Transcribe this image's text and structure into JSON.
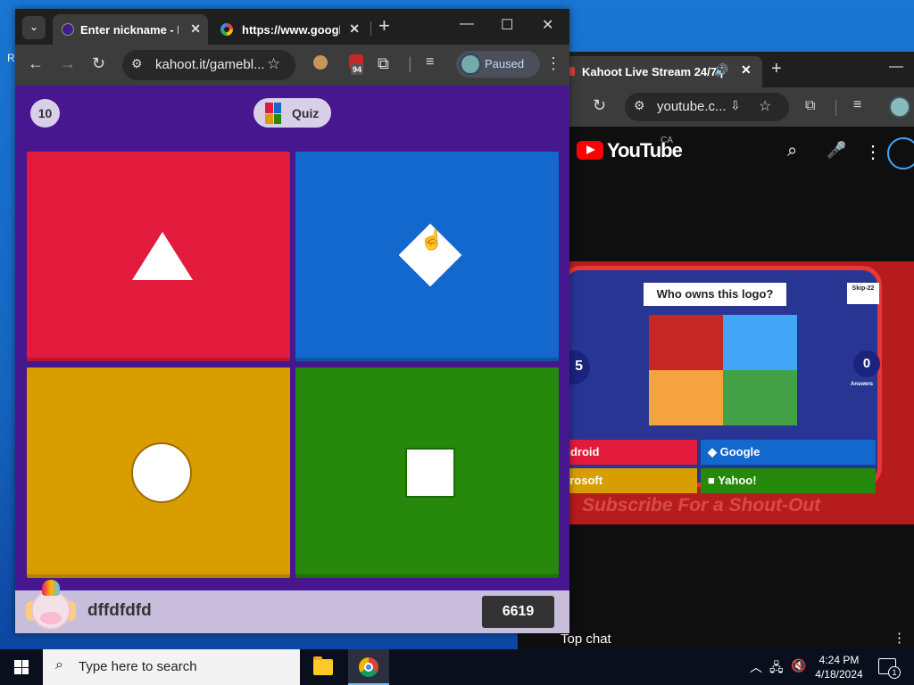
{
  "desktop": {
    "fragment": "R"
  },
  "kahoot_window": {
    "tabs": [
      {
        "title": "Enter nickname - Ka"
      },
      {
        "title": "https://www.google.c"
      }
    ],
    "address": "kahoot.it/gamebl...",
    "extension_badge": "94",
    "profile_status": "Paused"
  },
  "game": {
    "question_number": "10",
    "mode_label": "Quiz",
    "answers": [
      {
        "shape": "triangle-icon",
        "color": "#e21b3c"
      },
      {
        "shape": "diamond-icon",
        "color": "#1368ce"
      },
      {
        "shape": "circle-icon",
        "color": "#d89e00"
      },
      {
        "shape": "square-icon",
        "color": "#26890c"
      }
    ],
    "player": {
      "nickname": "dffdfdfd",
      "score": "6619"
    }
  },
  "youtube_window": {
    "tab_title": "Kahoot Live Stream 24/7 |",
    "address": "youtube.c...",
    "brand": "YouTube",
    "region": "CA",
    "video": {
      "question": "Who owns this logo?",
      "skip": "Skip-22",
      "left_count": "5",
      "answers_count": "0",
      "answers_label": "Answers",
      "options": [
        "ndroid",
        "Google",
        "crosoft",
        "Yahoo!"
      ],
      "overlay_text": "Subscribe For a Shout-Out"
    },
    "chat_label": "Top chat"
  },
  "taskbar": {
    "search_placeholder": "Type here to search",
    "time": "4:24 PM",
    "date": "4/18/2024",
    "notification_count": "1"
  },
  "colors": {
    "kahoot_purple": "#46178f",
    "youtube_red": "#ff0000"
  }
}
